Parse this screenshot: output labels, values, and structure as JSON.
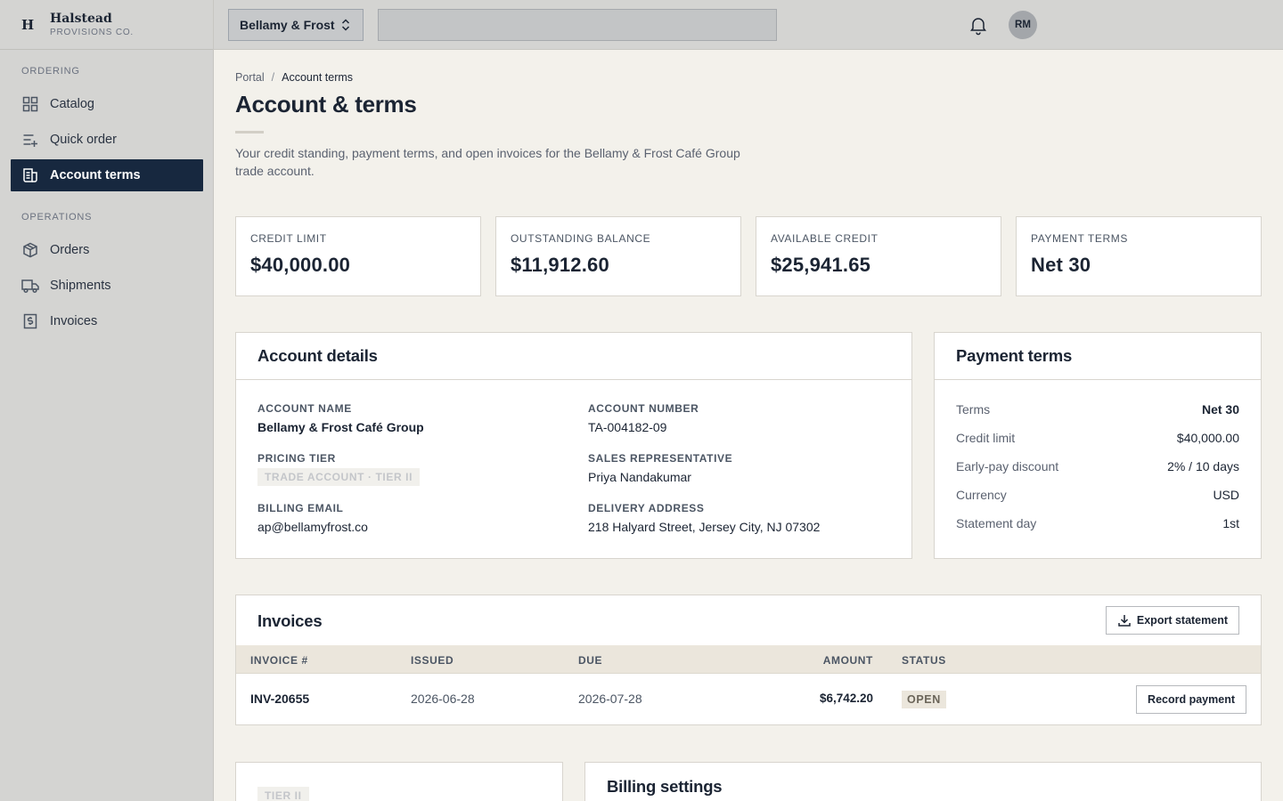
{
  "brand": {
    "mark": "H",
    "name": "Halstead",
    "sub": "PROVISIONS CO."
  },
  "topbar": {
    "account": "Bellamy & Frost",
    "search_placeholder": "",
    "avatar": "RM"
  },
  "sidebar": {
    "groups": [
      {
        "label": "ORDERING"
      },
      {
        "label": "OPERATIONS"
      }
    ],
    "items": [
      {
        "label": "Catalog",
        "icon": "grid-icon"
      },
      {
        "label": "Quick order",
        "icon": "list-plus-icon"
      },
      {
        "label": "Account terms",
        "icon": "receipt-icon",
        "active": true
      },
      {
        "label": "Orders",
        "icon": "box-icon"
      },
      {
        "label": "Shipments",
        "icon": "truck-icon"
      },
      {
        "label": "Invoices",
        "icon": "dollar-doc-icon"
      }
    ]
  },
  "breadcrumb": {
    "root": "Portal",
    "sep": "/",
    "current": "Account terms"
  },
  "page": {
    "title": "Account & terms",
    "description": "Your credit standing, payment terms, and open invoices for the Bellamy & Frost Café Group trade account."
  },
  "stats": [
    {
      "label": "CREDIT LIMIT",
      "value": "$40,000.00"
    },
    {
      "label": "OUTSTANDING BALANCE",
      "value": "$11,912.60"
    },
    {
      "label": "AVAILABLE CREDIT",
      "value": "$25,941.65"
    },
    {
      "label": "PAYMENT TERMS",
      "value": "Net 30"
    }
  ],
  "account_details": {
    "title": "Account details",
    "account_name_label": "ACCOUNT NAME",
    "account_name": "Bellamy & Frost Café Group",
    "account_number_label": "ACCOUNT NUMBER",
    "account_number": "TA-004182-09",
    "pricing_tier_label": "PRICING TIER",
    "pricing_tier": "TRADE ACCOUNT · TIER II",
    "sales_rep_label": "SALES REPRESENTATIVE",
    "sales_rep": "Priya Nandakumar",
    "billing_email_label": "BILLING EMAIL",
    "billing_email": "ap@bellamyfrost.co",
    "delivery_label": "DELIVERY ADDRESS",
    "delivery": "218 Halyard Street, Jersey City, NJ 07302"
  },
  "payment_terms": {
    "title": "Payment terms",
    "rows": [
      {
        "k": "Terms",
        "v": "Net 30"
      },
      {
        "k": "Credit limit",
        "v": "$40,000.00"
      },
      {
        "k": "Early-pay discount",
        "v": "2% / 10 days"
      },
      {
        "k": "Currency",
        "v": "USD"
      },
      {
        "k": "Statement day",
        "v": "1st"
      }
    ]
  },
  "invoices": {
    "title": "Invoices",
    "export_label": "Export statement",
    "columns": [
      "INVOICE #",
      "ISSUED",
      "DUE",
      "AMOUNT",
      "STATUS"
    ],
    "rows": [
      {
        "number": "INV-20655",
        "issued": "2026-06-28",
        "due": "2026-07-28",
        "amount": "$6,742.20",
        "status": "OPEN",
        "action": "Record payment"
      }
    ]
  },
  "bottom": {
    "tier_badge": "TIER II",
    "billing_settings_title": "Billing settings"
  },
  "colors": {
    "sidebar_active": "#17283f",
    "page_bg": "#f3f1eb",
    "table_head": "#ebe6dc"
  }
}
